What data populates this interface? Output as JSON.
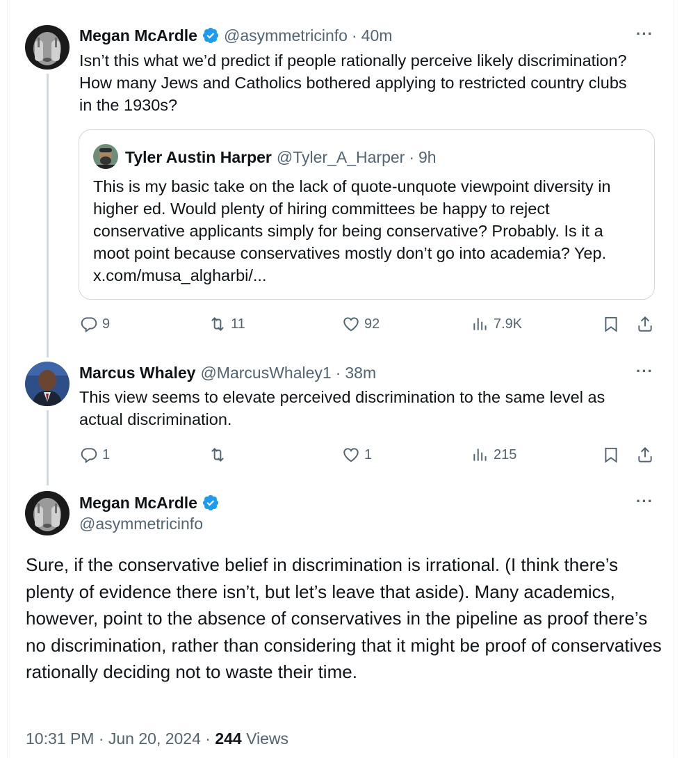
{
  "tweets": [
    {
      "author": "Megan McArdle",
      "verified": true,
      "handle": "@asymmetricinfo",
      "sep": "·",
      "time": "40m",
      "text": "Isn’t this what we’d predict if people rationally perceive likely discrimination? How many Jews and Catholics bothered applying to restricted country clubs in the 1930s?",
      "quote": {
        "author": "Tyler Austin Harper",
        "handle": "@Tyler_A_Harper",
        "sep": "·",
        "time": "9h",
        "text": "This is my basic take on the lack of quote-unquote viewpoint diversity in higher ed. Would plenty of hiring committees be happy to reject conservative applicants simply for being conservative? Probably. Is it a moot point because conservatives mostly don’t go into academia? Yep. x.com/musa_algharbi/..."
      },
      "stats": {
        "replies": "9",
        "reposts": "11",
        "likes": "92",
        "views": "7.9K"
      },
      "more_label": "···"
    },
    {
      "author": "Marcus Whaley",
      "verified": false,
      "handle": "@MarcusWhaley1",
      "sep": "·",
      "time": "38m",
      "text": "This view seems to elevate perceived discrimination to the same level as actual discrimination.",
      "stats": {
        "replies": "1",
        "reposts": "",
        "likes": "1",
        "views": "215"
      },
      "more_label": "···"
    }
  ],
  "main": {
    "author": "Megan McArdle",
    "verified": true,
    "handle": "@asymmetricinfo",
    "text": "Sure, if the conservative belief in discrimination is irrational. (I think there’s plenty of evidence there isn’t, but let’s leave that aside). Many academics, however, point to the absence of conservatives in the pipeline as proof there’s no discrimination, rather than considering that it might be proof of conservatives rationally deciding not to waste their time.",
    "timestamp": "10:31 PM · Jun 20, 2024 · ",
    "views_count": "244",
    "views_label": " Views",
    "more_label": "···"
  },
  "icons": {
    "reply": "reply-icon",
    "repost": "repost-icon",
    "like": "like-icon",
    "views": "views-icon",
    "bookmark": "bookmark-icon",
    "share": "share-icon",
    "verified": "verified-badge-icon"
  },
  "colors": {
    "verified": "#1d9bf0",
    "secondary": "#536471",
    "border": "#cfd9de"
  }
}
